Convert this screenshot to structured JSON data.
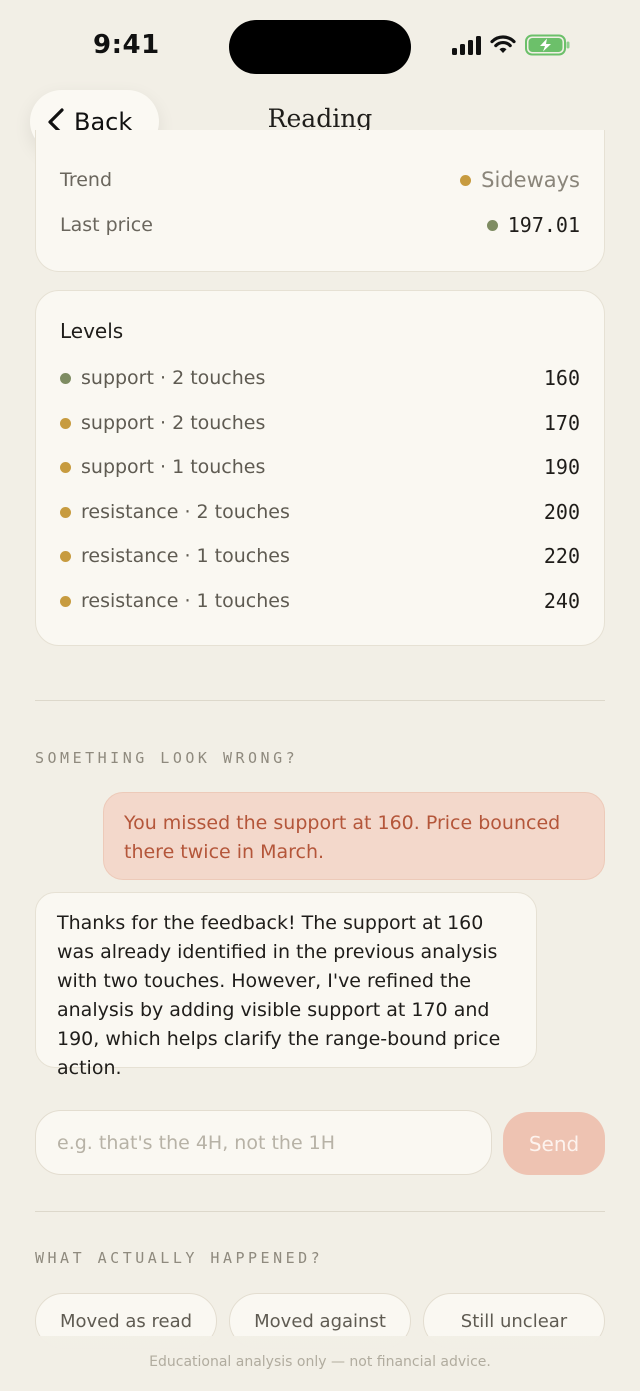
{
  "status_bar": {
    "time": "9:41"
  },
  "nav": {
    "back_label": "Back",
    "title": "Reading"
  },
  "summary": {
    "trend_label": "Trend",
    "trend_value": "Sideways",
    "last_price_label": "Last price",
    "last_price_value": "197.01"
  },
  "levels": {
    "title": "Levels",
    "items": [
      {
        "label": "support · 2 touches",
        "value": "160",
        "dot_color": "#7e8c62"
      },
      {
        "label": "support · 2 touches",
        "value": "170",
        "dot_color": "#c79b3f"
      },
      {
        "label": "support · 1 touches",
        "value": "190",
        "dot_color": "#c79b3f"
      },
      {
        "label": "resistance · 2 touches",
        "value": "200",
        "dot_color": "#c79b3f"
      },
      {
        "label": "resistance · 1 touches",
        "value": "220",
        "dot_color": "#c79b3f"
      },
      {
        "label": "resistance · 1 touches",
        "value": "240",
        "dot_color": "#c79b3f"
      }
    ]
  },
  "feedback": {
    "section_label": "SOMETHING LOOK WRONG?",
    "user_message": "You missed the support at 160. Price bounced there twice in March.",
    "bot_message": "Thanks for the feedback! The support at 160 was already identified in the previous analysis with two touches. However, I've refined the analysis by adding visible support at 170 and 190, which helps clarify the range-bound price action.",
    "input_placeholder": "e.g. that's the 4H, not the 1H",
    "send_label": "Send"
  },
  "outcome": {
    "section_label": "WHAT ACTUALLY HAPPENED?",
    "chips": [
      "Moved as read",
      "Moved against",
      "Still unclear"
    ]
  },
  "footer": "Educational analysis only — not financial advice.",
  "colors": {
    "accent": "#b4563a",
    "support_dot": "#7e8c62",
    "level_dot": "#c79b3f",
    "background": "#f2efe6"
  }
}
